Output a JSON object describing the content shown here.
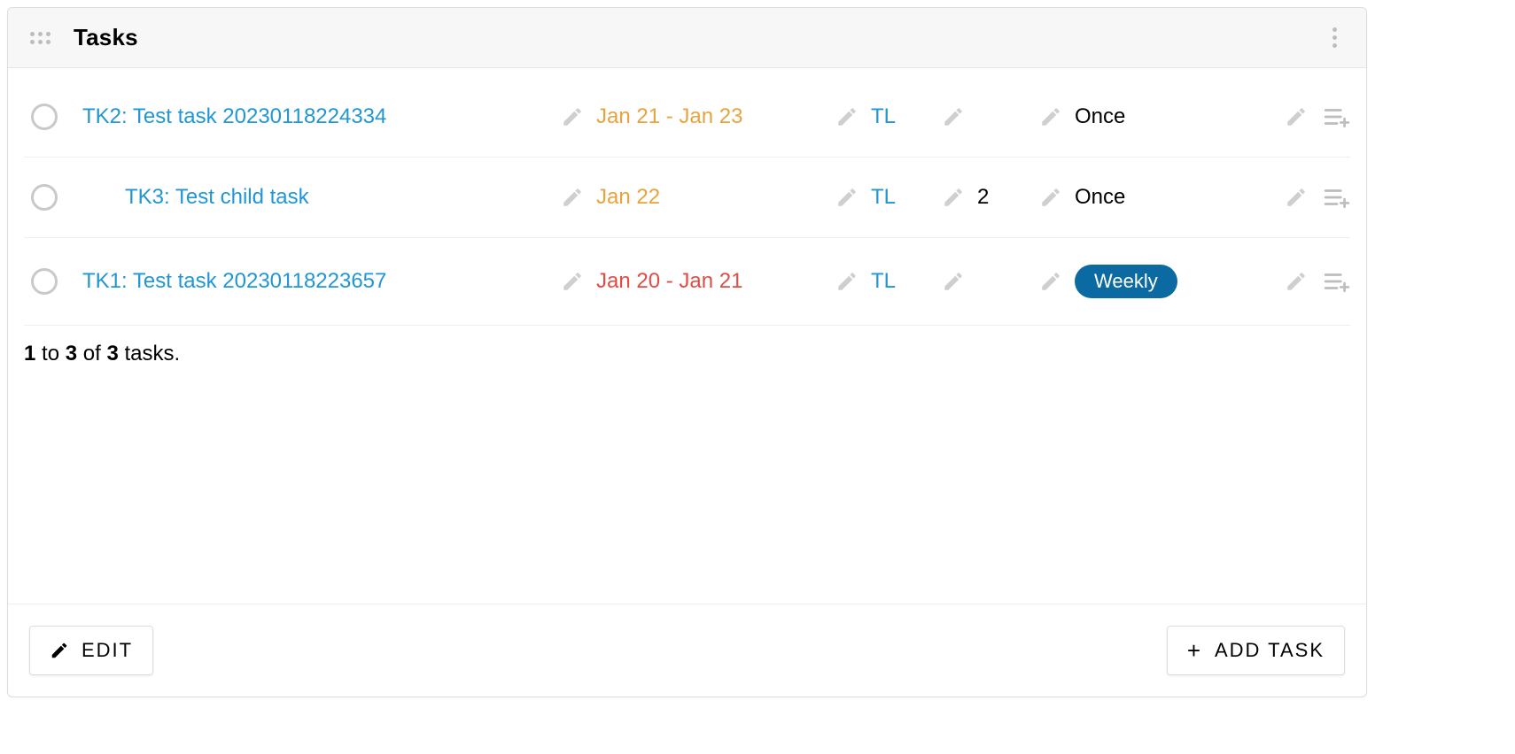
{
  "panel": {
    "title": "Tasks"
  },
  "tasks": [
    {
      "title": "TK2: Test task 20230118224334",
      "indented": false,
      "date": "Jan 21 - Jan 23",
      "date_color": "orange",
      "owner": "TL",
      "count": "",
      "recurrence": "Once",
      "recurrence_badge": false
    },
    {
      "title": "TK3: Test child task",
      "indented": true,
      "date": "Jan 22",
      "date_color": "orange",
      "owner": "TL",
      "count": "2",
      "recurrence": "Once",
      "recurrence_badge": false
    },
    {
      "title": "TK1: Test task 20230118223657",
      "indented": false,
      "date": "Jan 20 - Jan 21",
      "date_color": "red",
      "owner": "TL",
      "count": "",
      "recurrence": "Weekly",
      "recurrence_badge": true
    }
  ],
  "pager": {
    "from": "1",
    "to": "3",
    "total": "3",
    "word_to": " to ",
    "word_of": " of ",
    "word_tasks": " tasks."
  },
  "footer": {
    "edit_label": "EDIT",
    "add_task_label": "ADD TASK"
  }
}
